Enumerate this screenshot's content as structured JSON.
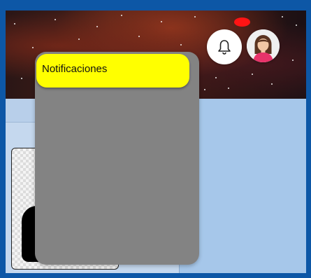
{
  "header": {
    "bell_icon": "bell-icon",
    "badge_color": "#ff1414",
    "avatar_icon": "user-avatar-icon"
  },
  "dropdown": {
    "title": "Notificaciones",
    "header_color": "#ffff00",
    "panel_color": "#838383"
  },
  "colors": {
    "frame": "#0d57a6",
    "background": "#a6c7ea"
  }
}
